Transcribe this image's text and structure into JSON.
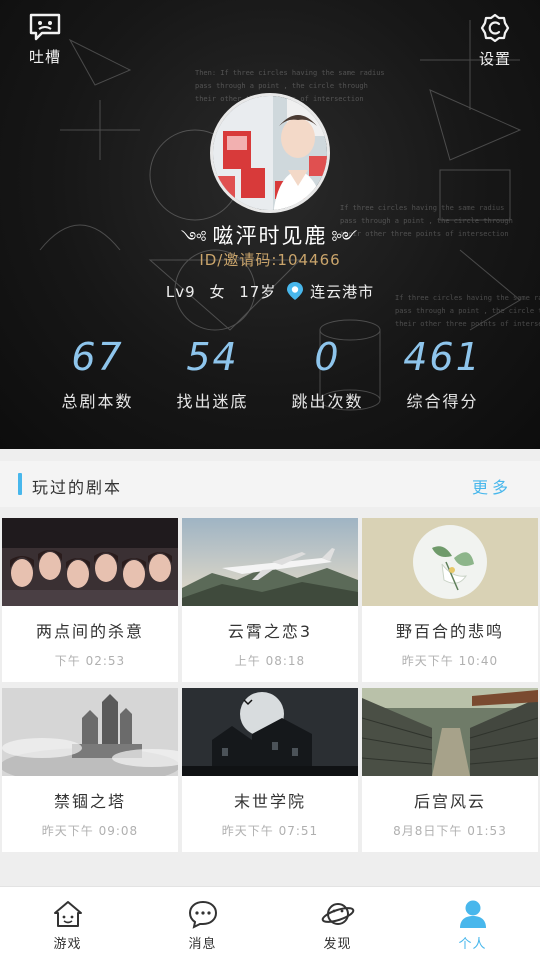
{
  "header": {
    "feedback_label": "吐槽",
    "settings_label": "设置",
    "nickname": "嗞泙时见鹿",
    "invite_code": "ID/邀请码:104466",
    "level": "Lv9",
    "gender": "女",
    "age": "17岁",
    "location": "连云港市"
  },
  "stats": [
    {
      "value": "67",
      "label": "总剧本数"
    },
    {
      "value": "54",
      "label": "找出迷底"
    },
    {
      "value": "0",
      "label": "跳出次数"
    },
    {
      "value": "461",
      "label": "综合得分"
    }
  ],
  "section": {
    "title": "玩过的剧本",
    "more": "更多"
  },
  "scripts": [
    {
      "name": "两点间的杀意",
      "time": "下午 02:53",
      "thumb": "group-portrait"
    },
    {
      "name": "云霄之恋3",
      "time": "上午 08:18",
      "thumb": "airplane"
    },
    {
      "name": "野百合的悲鸣",
      "time": "昨天下午 10:40",
      "thumb": "lily"
    },
    {
      "name": "禁锢之塔",
      "time": "昨天下午 09:08",
      "thumb": "tower"
    },
    {
      "name": "末世学院",
      "time": "昨天下午 07:51",
      "thumb": "haunted-mansion"
    },
    {
      "name": "后宫风云",
      "time": "8月8日下午 01:53",
      "thumb": "palace-alley"
    }
  ],
  "nav": [
    {
      "label": "游戏",
      "icon": "house-face-icon"
    },
    {
      "label": "消息",
      "icon": "chat-bubble-icon"
    },
    {
      "label": "发现",
      "icon": "planet-icon"
    },
    {
      "label": "个人",
      "icon": "person-icon",
      "active": true
    }
  ],
  "colors": {
    "accent": "#48b7ec",
    "stat_number": "#8ec5ec",
    "invite": "#c9a46b",
    "header_bg": "#171717"
  }
}
